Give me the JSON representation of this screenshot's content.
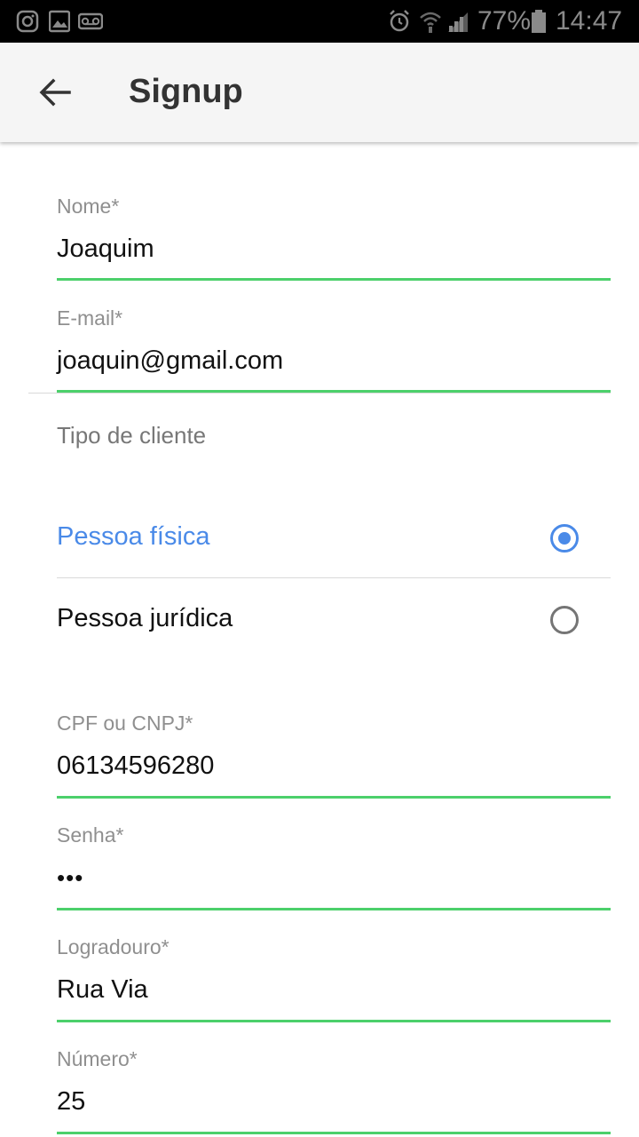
{
  "status_bar": {
    "battery_percent": "77%",
    "time": "14:47",
    "left_icons": [
      "instagram-icon",
      "gallery-icon",
      "voicemail-icon"
    ],
    "right_icons": [
      "alarm-icon",
      "wifi-icon",
      "signal-icon",
      "battery-icon"
    ]
  },
  "app_bar": {
    "title": "Signup",
    "back_icon": "arrow-back-icon"
  },
  "form": {
    "nome": {
      "label": "Nome*",
      "value": "Joaquim"
    },
    "email": {
      "label": "E-mail*",
      "value": "joaquin@gmail.com"
    },
    "tipo_cliente": {
      "label": "Tipo de cliente",
      "options": [
        {
          "label": "Pessoa física",
          "selected": true
        },
        {
          "label": "Pessoa jurídica",
          "selected": false
        }
      ]
    },
    "cpf_cnpj": {
      "label": "CPF ou CNPJ*",
      "value": "06134596280"
    },
    "senha": {
      "label": "Senha*",
      "value": "•••"
    },
    "logradouro": {
      "label": "Logradouro*",
      "value": "Rua Via"
    },
    "numero": {
      "label": "Número*",
      "value": "25"
    }
  },
  "colors": {
    "accent_green": "#4cd06b",
    "selected_blue": "#4a8ae8",
    "app_bar_bg": "#f5f5f5"
  }
}
